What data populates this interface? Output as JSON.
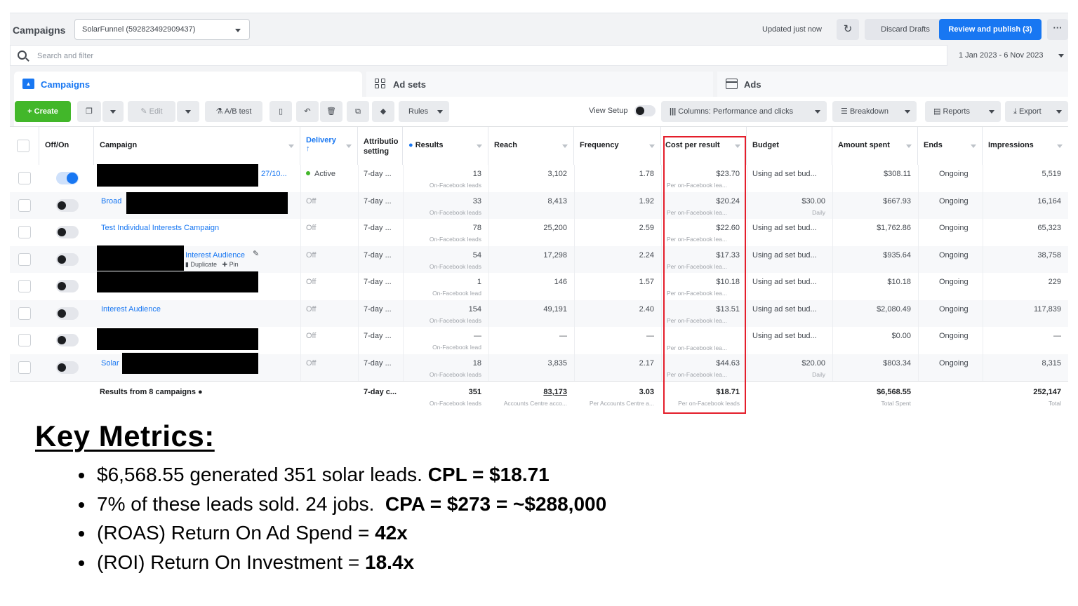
{
  "topbar": {
    "title": "Campaigns",
    "account": "SolarFunnel (592823492909437)",
    "updated": "Updated just now",
    "discard": "Discard Drafts",
    "publish": "Review and publish (3)",
    "more": "···"
  },
  "search": {
    "placeholder": "Search and filter"
  },
  "date_range": "1 Jan 2023 - 6 Nov 2023",
  "tabs": {
    "campaigns": "Campaigns",
    "adsets": "Ad sets",
    "ads": "Ads"
  },
  "toolbar": {
    "create": "Create",
    "edit": "Edit",
    "ab_test": "A/B test",
    "rules": "Rules",
    "view_setup": "View Setup",
    "columns": "Columns: Performance and clicks",
    "breakdown": "Breakdown",
    "reports": "Reports",
    "export": "Export"
  },
  "columns": {
    "off_on": "Off/On",
    "campaign": "Campaign",
    "delivery": "Delivery",
    "attribution_1": "Attributio",
    "attribution_2": "setting",
    "results": "Results",
    "reach": "Reach",
    "frequency": "Frequency",
    "cpr": "Cost per result",
    "budget": "Budget",
    "amount_spent": "Amount spent",
    "ends": "Ends",
    "impressions": "Impressions"
  },
  "rows": [
    {
      "name": "27/10...",
      "delivery": "Active",
      "attr": "7-day ...",
      "results": "13",
      "results_sub": "On-Facebook leads",
      "reach": "3,102",
      "freq": "1.78",
      "cpr": "$23.70",
      "cpr_sub": "Per on-Facebook lea...",
      "budget": "Using ad set bud...",
      "budget_sub": "",
      "spent": "$308.11",
      "ends": "Ongoing",
      "impr": "5,519"
    },
    {
      "name": "Broad",
      "delivery": "Off",
      "attr": "7-day ...",
      "results": "33",
      "results_sub": "On-Facebook leads",
      "reach": "8,413",
      "freq": "1.92",
      "cpr": "$20.24",
      "cpr_sub": "Per on-Facebook lea...",
      "budget": "$30.00",
      "budget_sub": "Daily",
      "spent": "$667.93",
      "ends": "Ongoing",
      "impr": "16,164"
    },
    {
      "name": "Test Individual Interests Campaign",
      "delivery": "Off",
      "attr": "7-day ...",
      "results": "78",
      "results_sub": "On-Facebook leads",
      "reach": "25,200",
      "freq": "2.59",
      "cpr": "$22.60",
      "cpr_sub": "Per on-Facebook lea...",
      "budget": "Using ad set bud...",
      "budget_sub": "",
      "spent": "$1,762.86",
      "ends": "Ongoing",
      "impr": "65,323"
    },
    {
      "name": "Interest Audience",
      "delivery": "Off",
      "attr": "7-day ...",
      "results": "54",
      "results_sub": "On-Facebook leads",
      "reach": "17,298",
      "freq": "2.24",
      "cpr": "$17.33",
      "cpr_sub": "Per on-Facebook lea...",
      "budget": "Using ad set bud...",
      "budget_sub": "",
      "spent": "$935.64",
      "ends": "Ongoing",
      "impr": "38,758",
      "duplicate": "Duplicate",
      "pin": "Pin"
    },
    {
      "name": "",
      "delivery": "Off",
      "attr": "7-day ...",
      "results": "1",
      "results_sub": "On-Facebook lead",
      "reach": "146",
      "freq": "1.57",
      "cpr": "$10.18",
      "cpr_sub": "Per on-Facebook lea...",
      "budget": "Using ad set bud...",
      "budget_sub": "",
      "spent": "$10.18",
      "ends": "Ongoing",
      "impr": "229"
    },
    {
      "name": "Interest Audience",
      "delivery": "Off",
      "attr": "7-day ...",
      "results": "154",
      "results_sub": "On-Facebook leads",
      "reach": "49,191",
      "freq": "2.40",
      "cpr": "$13.51",
      "cpr_sub": "Per on-Facebook lea...",
      "budget": "Using ad set bud...",
      "budget_sub": "",
      "spent": "$2,080.49",
      "ends": "Ongoing",
      "impr": "117,839"
    },
    {
      "name": "",
      "delivery": "Off",
      "attr": "7-day ...",
      "results": "—",
      "results_sub": "On-Facebook lead",
      "reach": "—",
      "freq": "—",
      "cpr": "",
      "cpr_sub": "Per on-Facebook lea...",
      "budget": "Using ad set bud...",
      "budget_sub": "",
      "spent": "$0.00",
      "ends": "Ongoing",
      "impr": "—"
    },
    {
      "name": "Solar",
      "delivery": "Off",
      "attr": "7-day ...",
      "results": "18",
      "results_sub": "On-Facebook leads",
      "reach": "3,835",
      "freq": "2.17",
      "cpr": "$44.63",
      "cpr_sub": "Per on-Facebook lea...",
      "budget": "$20.00",
      "budget_sub": "Daily",
      "spent": "$803.34",
      "ends": "Ongoing",
      "impr": "8,315"
    }
  ],
  "totals": {
    "label": "Results from 8 campaigns",
    "attr": "7-day c...",
    "results": "351",
    "results_sub": "On-Facebook leads",
    "reach": "83,173",
    "reach_sub": "Accounts Centre acco...",
    "freq": "3.03",
    "freq_sub": "Per Accounts Centre a...",
    "cpr": "$18.71",
    "cpr_sub": "Per on-Facebook leads",
    "spent": "$6,568.55",
    "spent_sub": "Total Spent",
    "impr": "252,147",
    "impr_sub": "Total"
  },
  "key_metrics": {
    "title": "Key Metrics:",
    "b1_text": "$6,568.55 generated 351 solar leads. ",
    "b1_bold": "CPL = $18.71",
    "b2_text": "7% of these leads sold. 24 jobs.  ",
    "b2_bold": "CPA = $273 = ~$288,000",
    "b3_text": "(ROAS) Return On Ad Spend = ",
    "b3_bold": "42x",
    "b4_text": "(ROI) Return On Investment = ",
    "b4_bold": "18.4x"
  },
  "colors": {
    "accent": "#1877f2",
    "create": "#42b72a",
    "highlight": "#e41e2b"
  }
}
